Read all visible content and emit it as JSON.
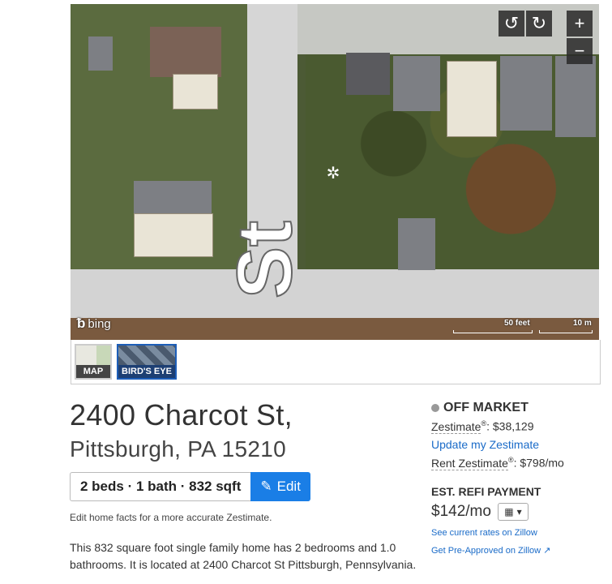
{
  "map": {
    "street_label": "St",
    "provider": "bing",
    "scale_feet": "50 feet",
    "scale_m": "10 m",
    "controls": {
      "rotate_left_icon": "↺",
      "rotate_right_icon": "↻",
      "zoom_in": "+",
      "zoom_out": "−"
    },
    "types": [
      {
        "label": "MAP"
      },
      {
        "label": "BIRD'S EYE"
      }
    ]
  },
  "listing": {
    "address_line1": "2400 Charcot St,",
    "address_line2": "Pittsburgh, PA 15210",
    "facts": "2 beds · 1 bath · 832 sqft",
    "edit_label": "Edit",
    "edit_hint": "Edit home facts for a more accurate Zestimate.",
    "description": "This 832 square foot single family home has 2 bedrooms and 1.0 bathrooms. It is located at 2400 Charcot St Pittsburgh, Pennsylvania."
  },
  "sidebar": {
    "status": "OFF MARKET",
    "zestimate_label": "Zestimate",
    "zestimate_value": ": $38,129",
    "update_link": "Update my Zestimate",
    "rent_label": "Rent Zestimate",
    "rent_value": ": $798/mo",
    "refi_title": "EST. REFI PAYMENT",
    "refi_amount": "$142/mo",
    "rates_link": "See current rates on Zillow",
    "preapproved_link": "Get Pre-Approved on Zillow"
  },
  "colors": {
    "accent": "#1a7ee6",
    "link": "#1a6bc8",
    "status_dot": "#999999"
  }
}
